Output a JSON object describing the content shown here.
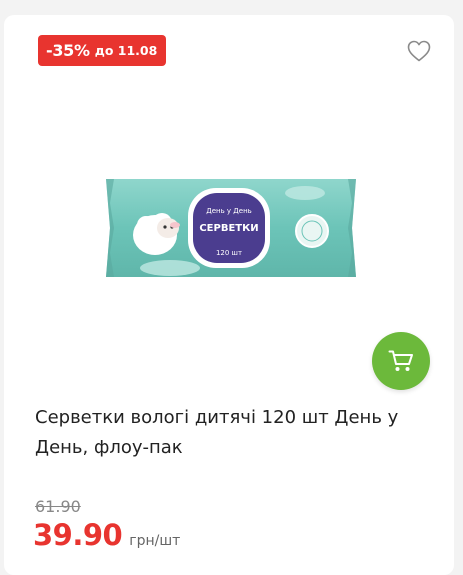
{
  "badge": {
    "discount": "-35%",
    "until": "до 11.08"
  },
  "product": {
    "title": "Серветки вологі дитячі 120 шт День у День, флоу-пак",
    "package": {
      "brand": "День у День",
      "name": "СЕРВЕТКИ",
      "count": "120 шт"
    }
  },
  "price": {
    "old": "61.90",
    "current": "39.90",
    "unit": "грн/шт"
  },
  "colors": {
    "accent": "#e8342f",
    "cart": "#6cb93b",
    "pack": "#7cc9bf",
    "label": "#4b3d8f"
  },
  "icons": {
    "favorite": "heart-icon",
    "cart": "cart-icon"
  }
}
